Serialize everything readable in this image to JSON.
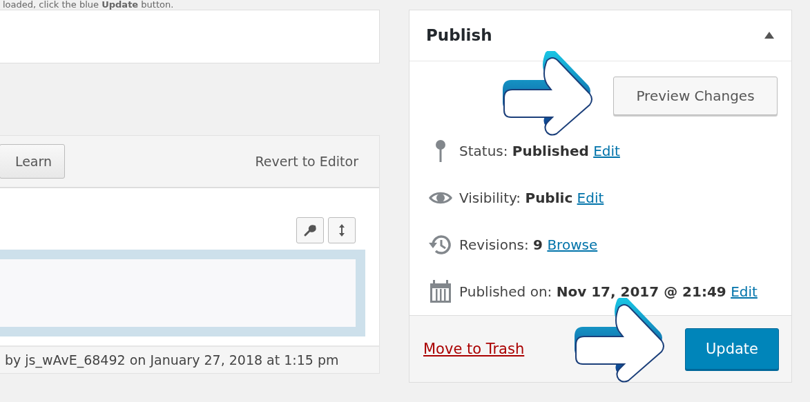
{
  "instruction": "loaded, click the blue **Update** button.",
  "editor": {
    "toolbar_button": "Learn",
    "revert_link": "Revert to Editor",
    "footer": "by js_wAvE_68492 on January 27, 2018 at 1:15 pm"
  },
  "publish": {
    "title": "Publish",
    "expanded": true,
    "preview_button": "Preview Changes",
    "rows": [
      {
        "kind": "status",
        "label": "Status:",
        "value": "Published",
        "link": "Edit"
      },
      {
        "kind": "visibility",
        "label": "Visibility:",
        "value": "Public",
        "link": "Edit"
      },
      {
        "kind": "revisions",
        "label": "Revisions:",
        "value": "9",
        "link": "Browse"
      },
      {
        "kind": "date",
        "label": "Published on:",
        "value": "Nov 17, 2017 @ 21:49",
        "link": "Edit"
      }
    ],
    "trash_link": "Move to Trash",
    "update_button": "Update"
  }
}
